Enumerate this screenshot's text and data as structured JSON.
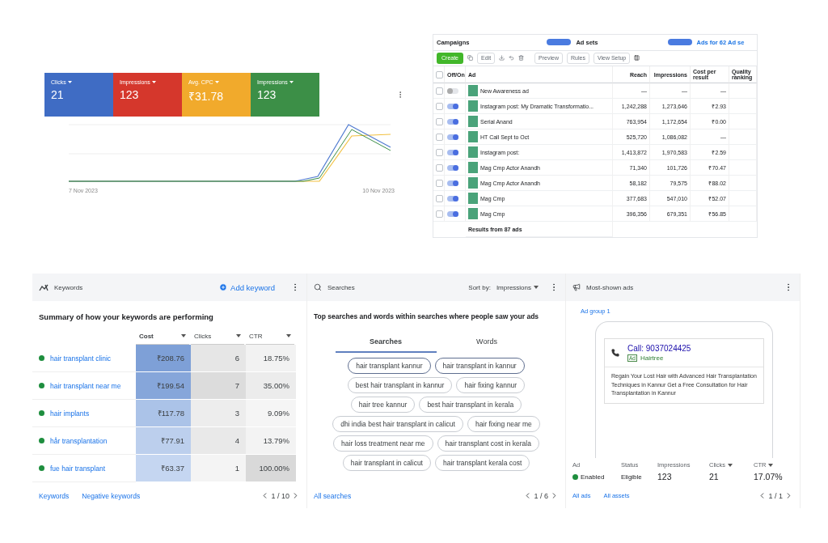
{
  "overview": {
    "metrics": [
      {
        "label": "Clicks",
        "value": "21",
        "color": "#3f6cc4"
      },
      {
        "label": "Impressions",
        "value": "123",
        "color": "#d5372c"
      },
      {
        "label": "Avg. CPC",
        "value": "₹31.78",
        "color": "#f1aa2c"
      },
      {
        "label": "Impressions",
        "value": "123",
        "color": "#3c8f47"
      }
    ],
    "chart_start": "7 Nov 2023",
    "chart_end": "10 Nov 2023"
  },
  "ads_manager": {
    "tabs": [
      {
        "label": "Campaigns",
        "selected": false
      },
      {
        "label": "Ad sets",
        "selected": false
      },
      {
        "label": "Ads for 62 Ad se",
        "selected": true
      }
    ],
    "toolbar": {
      "create": "Create",
      "edit": "Edit",
      "preview": "Preview",
      "rules": "Rules",
      "view_setup": "View Setup"
    },
    "all_checked": false,
    "columns": [
      "Off/On",
      "Ad",
      "Reach",
      "Impressions",
      "Cost per result",
      "Quality ranking"
    ],
    "rows": [
      {
        "checked": false,
        "on": false,
        "ad": "New Awareness ad",
        "reach": "—",
        "impressions": "—",
        "cost": "—"
      },
      {
        "checked": false,
        "on": true,
        "ad": "Instagram post: My Dramatic Transformatio...",
        "reach": "1,242,288",
        "impressions": "1,273,646",
        "cost": "₹2.93"
      },
      {
        "checked": false,
        "on": true,
        "ad": "Serial Anand",
        "reach": "763,954",
        "impressions": "1,172,654",
        "cost": "₹0.00"
      },
      {
        "checked": false,
        "on": true,
        "ad": "HT Call Sept to Oct",
        "reach": "525,720",
        "impressions": "1,086,082",
        "cost": "—"
      },
      {
        "checked": false,
        "on": true,
        "ad": "Instagram post:",
        "reach": "1,413,872",
        "impressions": "1,970,583",
        "cost": "₹2.59"
      },
      {
        "checked": false,
        "on": true,
        "ad": "Mag Cmp Actor Anandh",
        "reach": "71,340",
        "impressions": "101,726",
        "cost": "₹70.47"
      },
      {
        "checked": false,
        "on": true,
        "ad": "Mag Cmp Actor Anandh",
        "reach": "58,182",
        "impressions": "79,575",
        "cost": "₹88.02"
      },
      {
        "checked": false,
        "on": true,
        "ad": "Mag Cmp",
        "reach": "377,683",
        "impressions": "547,010",
        "cost": "₹52.07"
      },
      {
        "checked": false,
        "on": true,
        "ad": "Mag Cmp",
        "reach": "396,356",
        "impressions": "679,351",
        "cost": "₹56.85"
      }
    ],
    "footer": "Results from 87 ads"
  },
  "keywords": {
    "title": "Keywords",
    "add": "Add keyword",
    "summary": "Summary of how your keywords are performing",
    "columns": [
      "Cost",
      "Clicks",
      "CTR"
    ],
    "rows": [
      {
        "keyword": "hair transplant clinic",
        "cost": {
          "value": "₹208.76",
          "color": "#7ea0d7"
        },
        "clicks": {
          "value": "6",
          "color": "#e6e6e6"
        },
        "ctr": {
          "value": "18.75%",
          "color": "#f2f2f2"
        }
      },
      {
        "keyword": "hair transplant near me",
        "cost": {
          "value": "₹199.54",
          "color": "#86a6da"
        },
        "clicks": {
          "value": "7",
          "color": "#dcdcdc"
        },
        "ctr": {
          "value": "35.00%",
          "color": "#ececec"
        }
      },
      {
        "keyword": "hair implants",
        "cost": {
          "value": "₹117.78",
          "color": "#abc3e8"
        },
        "clicks": {
          "value": "3",
          "color": "#ededed"
        },
        "ctr": {
          "value": "9.09%",
          "color": "#f5f5f5"
        }
      },
      {
        "keyword": "hår transplantation",
        "cost": {
          "value": "₹77.91",
          "color": "#bccfed"
        },
        "clicks": {
          "value": "4",
          "color": "#e9e9e9"
        },
        "ctr": {
          "value": "13.79%",
          "color": "#f3f3f3"
        }
      },
      {
        "keyword": "fue hair transplant",
        "cost": {
          "value": "₹63.37",
          "color": "#c5d6f1"
        },
        "clicks": {
          "value": "1",
          "color": "#f4f4f4"
        },
        "ctr": {
          "value": "100.00%",
          "color": "#d9d9d9"
        }
      }
    ],
    "links": [
      "Keywords",
      "Negative keywords"
    ],
    "page": "1 / 10"
  },
  "searches": {
    "title": "Searches",
    "sort_label": "Sort by:",
    "sort_value": "Impressions",
    "summary": "Top searches and words within searches where people saw your ads",
    "tabs": [
      {
        "label": "Searches",
        "selected": true
      },
      {
        "label": "Words",
        "selected": false
      }
    ],
    "chips": [
      [
        {
          "label": "hair transplant kannur",
          "selected": true
        },
        {
          "label": "hair transplant in kannur",
          "selected": true
        }
      ],
      [
        {
          "label": "best hair transplant in kannur",
          "selected": false
        },
        {
          "label": "hair fixing kannur",
          "selected": false
        }
      ],
      [
        {
          "label": "hair tree kannur",
          "selected": false
        },
        {
          "label": "best hair transplant in kerala",
          "selected": false
        }
      ],
      [
        {
          "label": "dhi india best hair transplant in calicut",
          "selected": false
        },
        {
          "label": "hair fixing near me",
          "selected": false
        }
      ],
      [
        {
          "label": "hair loss treatment near me",
          "selected": false
        },
        {
          "label": "hair transplant cost in kerala",
          "selected": false
        }
      ],
      [
        {
          "label": "hair transplant in calicut",
          "selected": false
        },
        {
          "label": "hair transplant kerala cost",
          "selected": false
        }
      ]
    ],
    "link": "All searches",
    "page": "1 / 6"
  },
  "most_shown": {
    "title": "Most-shown ads",
    "group": "Ad group 1",
    "call": "Call: 9037024425",
    "badge": "Ad",
    "advertiser": "Hairtree",
    "description": "Regain Your Lost Hair with Advanced Hair Transplantation Techniques in Kannur Get a Free Consultation for Hair Transplantation in Kannur",
    "stats": [
      {
        "label": "Ad",
        "value": "Enabled",
        "kind": "status"
      },
      {
        "label": "Status",
        "value": "Eligible",
        "kind": "plain"
      },
      {
        "label": "Impressions",
        "value": "123",
        "kind": "metric"
      },
      {
        "label": "Clicks",
        "value": "21",
        "kind": "sortable"
      },
      {
        "label": "CTR",
        "value": "17.07%",
        "kind": "sortable"
      }
    ],
    "links": [
      "All ads",
      "All assets"
    ],
    "page": "1 / 1"
  }
}
